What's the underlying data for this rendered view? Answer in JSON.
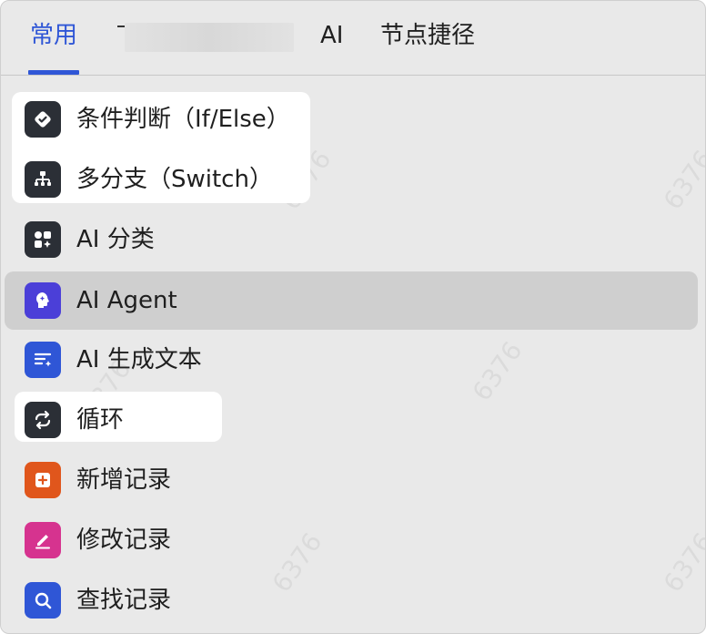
{
  "tabs": [
    {
      "label": "常用",
      "active": true
    },
    {
      "label": "",
      "redacted": true
    },
    {
      "label": "AI",
      "active": false
    },
    {
      "label": "节点捷径",
      "active": false
    }
  ],
  "items": [
    {
      "label": "条件判断（If/Else）",
      "icon": "condition-check-icon",
      "icon_bg": "#2b2f36",
      "highlighted": true
    },
    {
      "label": "多分支（Switch）",
      "icon": "branch-tree-icon",
      "icon_bg": "#2b2f36",
      "highlighted": true
    },
    {
      "label": "AI 分类",
      "icon": "ai-classify-icon",
      "icon_bg": "#2b2f36",
      "highlighted": false
    },
    {
      "label": "AI Agent",
      "icon": "ai-agent-head-icon",
      "icon_bg": "#4b3fd8",
      "hovered": true
    },
    {
      "label": "AI 生成文本",
      "icon": "ai-text-lines-icon",
      "icon_bg": "#2f56d6",
      "highlighted": false
    },
    {
      "label": "循环",
      "icon": "loop-arrows-icon",
      "icon_bg": "#2b2f36",
      "highlighted": true
    },
    {
      "label": "新增记录",
      "icon": "add-record-icon",
      "icon_bg": "#e0561c",
      "highlighted": false
    },
    {
      "label": "修改记录",
      "icon": "edit-record-icon",
      "icon_bg": "#d6338f",
      "highlighted": false
    },
    {
      "label": "查找记录",
      "icon": "search-record-icon",
      "icon_bg": "#2f56d6",
      "highlighted": false
    }
  ],
  "watermark": "6376"
}
